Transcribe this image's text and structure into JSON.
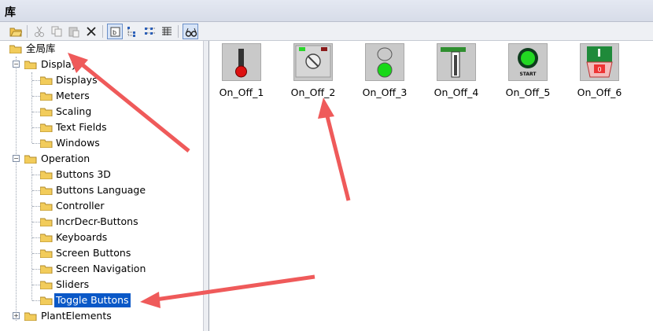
{
  "window": {
    "title": "库"
  },
  "toolbar": {
    "buttons": [
      {
        "icon": "folder-open-icon",
        "enabled": true
      },
      {
        "icon": "cut-icon",
        "enabled": false
      },
      {
        "icon": "copy-icon",
        "enabled": false
      },
      {
        "icon": "paste-icon",
        "enabled": false
      },
      {
        "icon": "delete-icon",
        "enabled": true
      },
      {
        "icon": "details-view-icon",
        "enabled": true,
        "active": true
      },
      {
        "icon": "tree-view-icon",
        "enabled": true
      },
      {
        "icon": "list-view-icon",
        "enabled": true
      },
      {
        "icon": "table-view-icon",
        "enabled": true
      },
      {
        "icon": "preview-glasses-icon",
        "enabled": true,
        "active": true
      }
    ]
  },
  "tree": {
    "root": "全局库",
    "groups": [
      {
        "label": "Display",
        "children": [
          "Displays",
          "Meters",
          "Scaling",
          "Text Fields",
          "Windows"
        ]
      },
      {
        "label": "Operation",
        "children": [
          "Buttons 3D",
          "Buttons Language",
          "Controller",
          "IncrDecr-Buttons",
          "Keyboards",
          "Screen Buttons",
          "Screen Navigation",
          "Sliders",
          "Toggle Buttons"
        ]
      },
      {
        "label": "PlantElements",
        "children": []
      }
    ],
    "selected": "Toggle Buttons"
  },
  "content": {
    "items": [
      {
        "name": "On_Off_1",
        "icon": "thermometer-switch-icon"
      },
      {
        "name": "On_Off_2",
        "icon": "rotary-switch-icon"
      },
      {
        "name": "On_Off_3",
        "icon": "indicator-lights-icon"
      },
      {
        "name": "On_Off_4",
        "icon": "lever-switch-icon"
      },
      {
        "name": "On_Off_5",
        "icon": "start-button-icon",
        "icon_text": "START"
      },
      {
        "name": "On_Off_6",
        "icon": "rocker-switch-icon",
        "icon_text": "0"
      }
    ]
  },
  "colors": {
    "selection": "#0a58c7",
    "annotation_arrow": "#ef5a5a",
    "folder": "#f2cc5b"
  }
}
